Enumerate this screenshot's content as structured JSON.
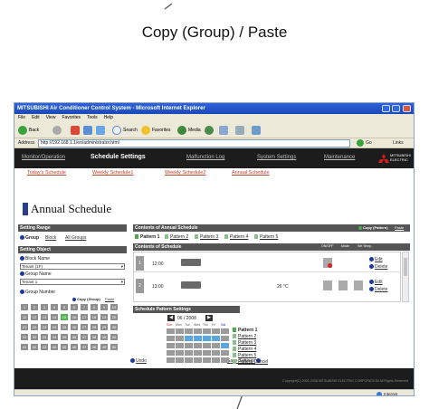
{
  "caption": "Copy (Group) / Paste",
  "window": {
    "title": "MITSUBISHI Air Conditioner Control System - Microsoft Internet Explorer",
    "menus": [
      "File",
      "Edit",
      "View",
      "Favorites",
      "Tools",
      "Help"
    ],
    "back": "Back",
    "search": "Search",
    "favorites": "Favorites",
    "media": "Media",
    "address_label": "Address",
    "url": "http://192.168.1.1/en/administrator.html",
    "go": "Go",
    "links": "Links"
  },
  "nav": {
    "items": [
      "Monitor/Operation",
      "Schedule Settings",
      "Malfunction Log",
      "System Settings",
      "Maintenance"
    ],
    "logo": "MITSUBISHI ELECTRIC"
  },
  "subnav": {
    "items": [
      "Today's Schedule",
      "Weekly Schedule1",
      "Weekly Schedule2",
      "Annual Schedule"
    ]
  },
  "page_title": "Annual Schedule",
  "setting_range": {
    "label": "Setting Range",
    "group": "Group",
    "block": "Block",
    "all": "All Groups"
  },
  "setting_object": {
    "label": "Setting Object",
    "block_name": "Block Name",
    "block_value": "Tenant (1F)",
    "group_name": "Group Name",
    "group_value": "Tenant 1",
    "group_number": "Group Number",
    "copy_group": "Copy (Group)",
    "paste": "Paste",
    "numbers": [
      "1",
      "2",
      "3",
      "4",
      "5",
      "6",
      "7",
      "8",
      "9",
      "10",
      "11",
      "12",
      "13",
      "14",
      "15",
      "16",
      "17",
      "18",
      "19",
      "20",
      "21",
      "22",
      "23",
      "24",
      "25",
      "26",
      "27",
      "28",
      "29",
      "30",
      "31",
      "32",
      "33",
      "34",
      "35",
      "36",
      "37",
      "38",
      "39",
      "40",
      "41",
      "42",
      "43",
      "44",
      "45",
      "46",
      "47",
      "48",
      "49",
      "50"
    ],
    "selected": "15"
  },
  "contents_annual": {
    "label": "Contents of Annual Schedule",
    "copy_pattern": "Copy (Pattern)",
    "paste": "Paste",
    "patterns": [
      "Pattern 1",
      "Pattern 2",
      "Pattern 3",
      "Pattern 4",
      "Pattern 5"
    ]
  },
  "contents_schedule": {
    "label": "Contents of Schedule",
    "cols": [
      "ON/OFF",
      "Mode",
      "Set Temp."
    ],
    "rows": [
      {
        "no": "1",
        "time": "12:00",
        "temp": "",
        "edit": "Edit",
        "delete": "Delete"
      },
      {
        "no": "2",
        "time": "13:00",
        "temp": "26 °C",
        "edit": "Edit",
        "delete": "Delete"
      }
    ]
  },
  "pattern_settings": {
    "label": "Schedule Pattern Settings",
    "month": "06 / 2008",
    "days": [
      "Sun",
      "Mon",
      "Tue",
      "Wed",
      "Thu",
      "Fri",
      "Sat"
    ],
    "patterns": [
      "Pattern 1",
      "Pattern 2",
      "Pattern 3",
      "Pattern 4",
      "Pattern 5",
      "Pattern Cancel"
    ]
  },
  "footer": {
    "undo": "Undo",
    "save": "Save Settings",
    "copyright": "Copyright(C) 2002-2008 MITSUBISHI ELECTRIC CORPORATION All Rights Reserved",
    "status": "Internet"
  }
}
